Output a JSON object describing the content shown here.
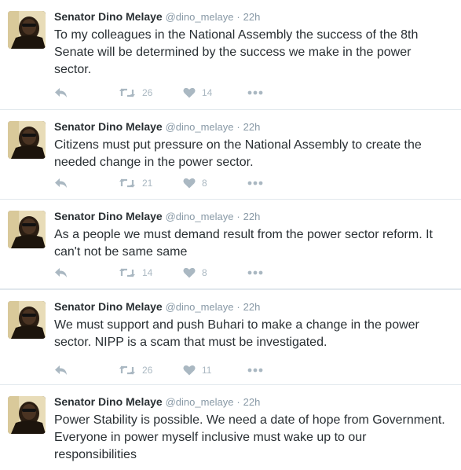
{
  "colors": {
    "text": "#292f33",
    "muted": "#8899a6",
    "icon": "#aab8c2",
    "border": "#e1e8ed"
  },
  "icons": {
    "reply": "reply-arrow-icon",
    "retweet": "retweet-icon",
    "like": "heart-icon",
    "more": "ellipsis-icon"
  },
  "tweets": [
    {
      "fullname": "Senator Dino Melaye",
      "username": "@dino_melaye",
      "dot": "·",
      "time": "22h",
      "text": "To my colleagues in the National Assembly the success of the 8th\nSenate will be determined by the success we make in the power\nsector.",
      "retweets": "26",
      "likes": "14"
    },
    {
      "fullname": "Senator Dino Melaye",
      "username": "@dino_melaye",
      "dot": "·",
      "time": "22h",
      "text": "Citizens must put pressure on the National Assembly to create the\nneeded change in the power sector.",
      "retweets": "21",
      "likes": "8"
    },
    {
      "fullname": "Senator Dino Melaye",
      "username": "@dino_melaye",
      "dot": "·",
      "time": "22h",
      "text": "As a people we must demand result from the power sector reform. It\ncan't not be same same",
      "retweets": "14",
      "likes": "8"
    },
    {
      "fullname": "Senator Dino Melaye",
      "username": "@dino_melaye",
      "dot": "·",
      "time": "22h",
      "text": "We must support and push Buhari to make a change in the power\nsector. NIPP is a scam that must be investigated.",
      "retweets": "26",
      "likes": "11"
    },
    {
      "fullname": "Senator Dino Melaye",
      "username": "@dino_melaye",
      "dot": "·",
      "time": "22h",
      "text": "Power Stability is possible. We need a date of hope from Government.\nEveryone in power myself inclusive must wake up to our\nresponsibilities"
    }
  ]
}
